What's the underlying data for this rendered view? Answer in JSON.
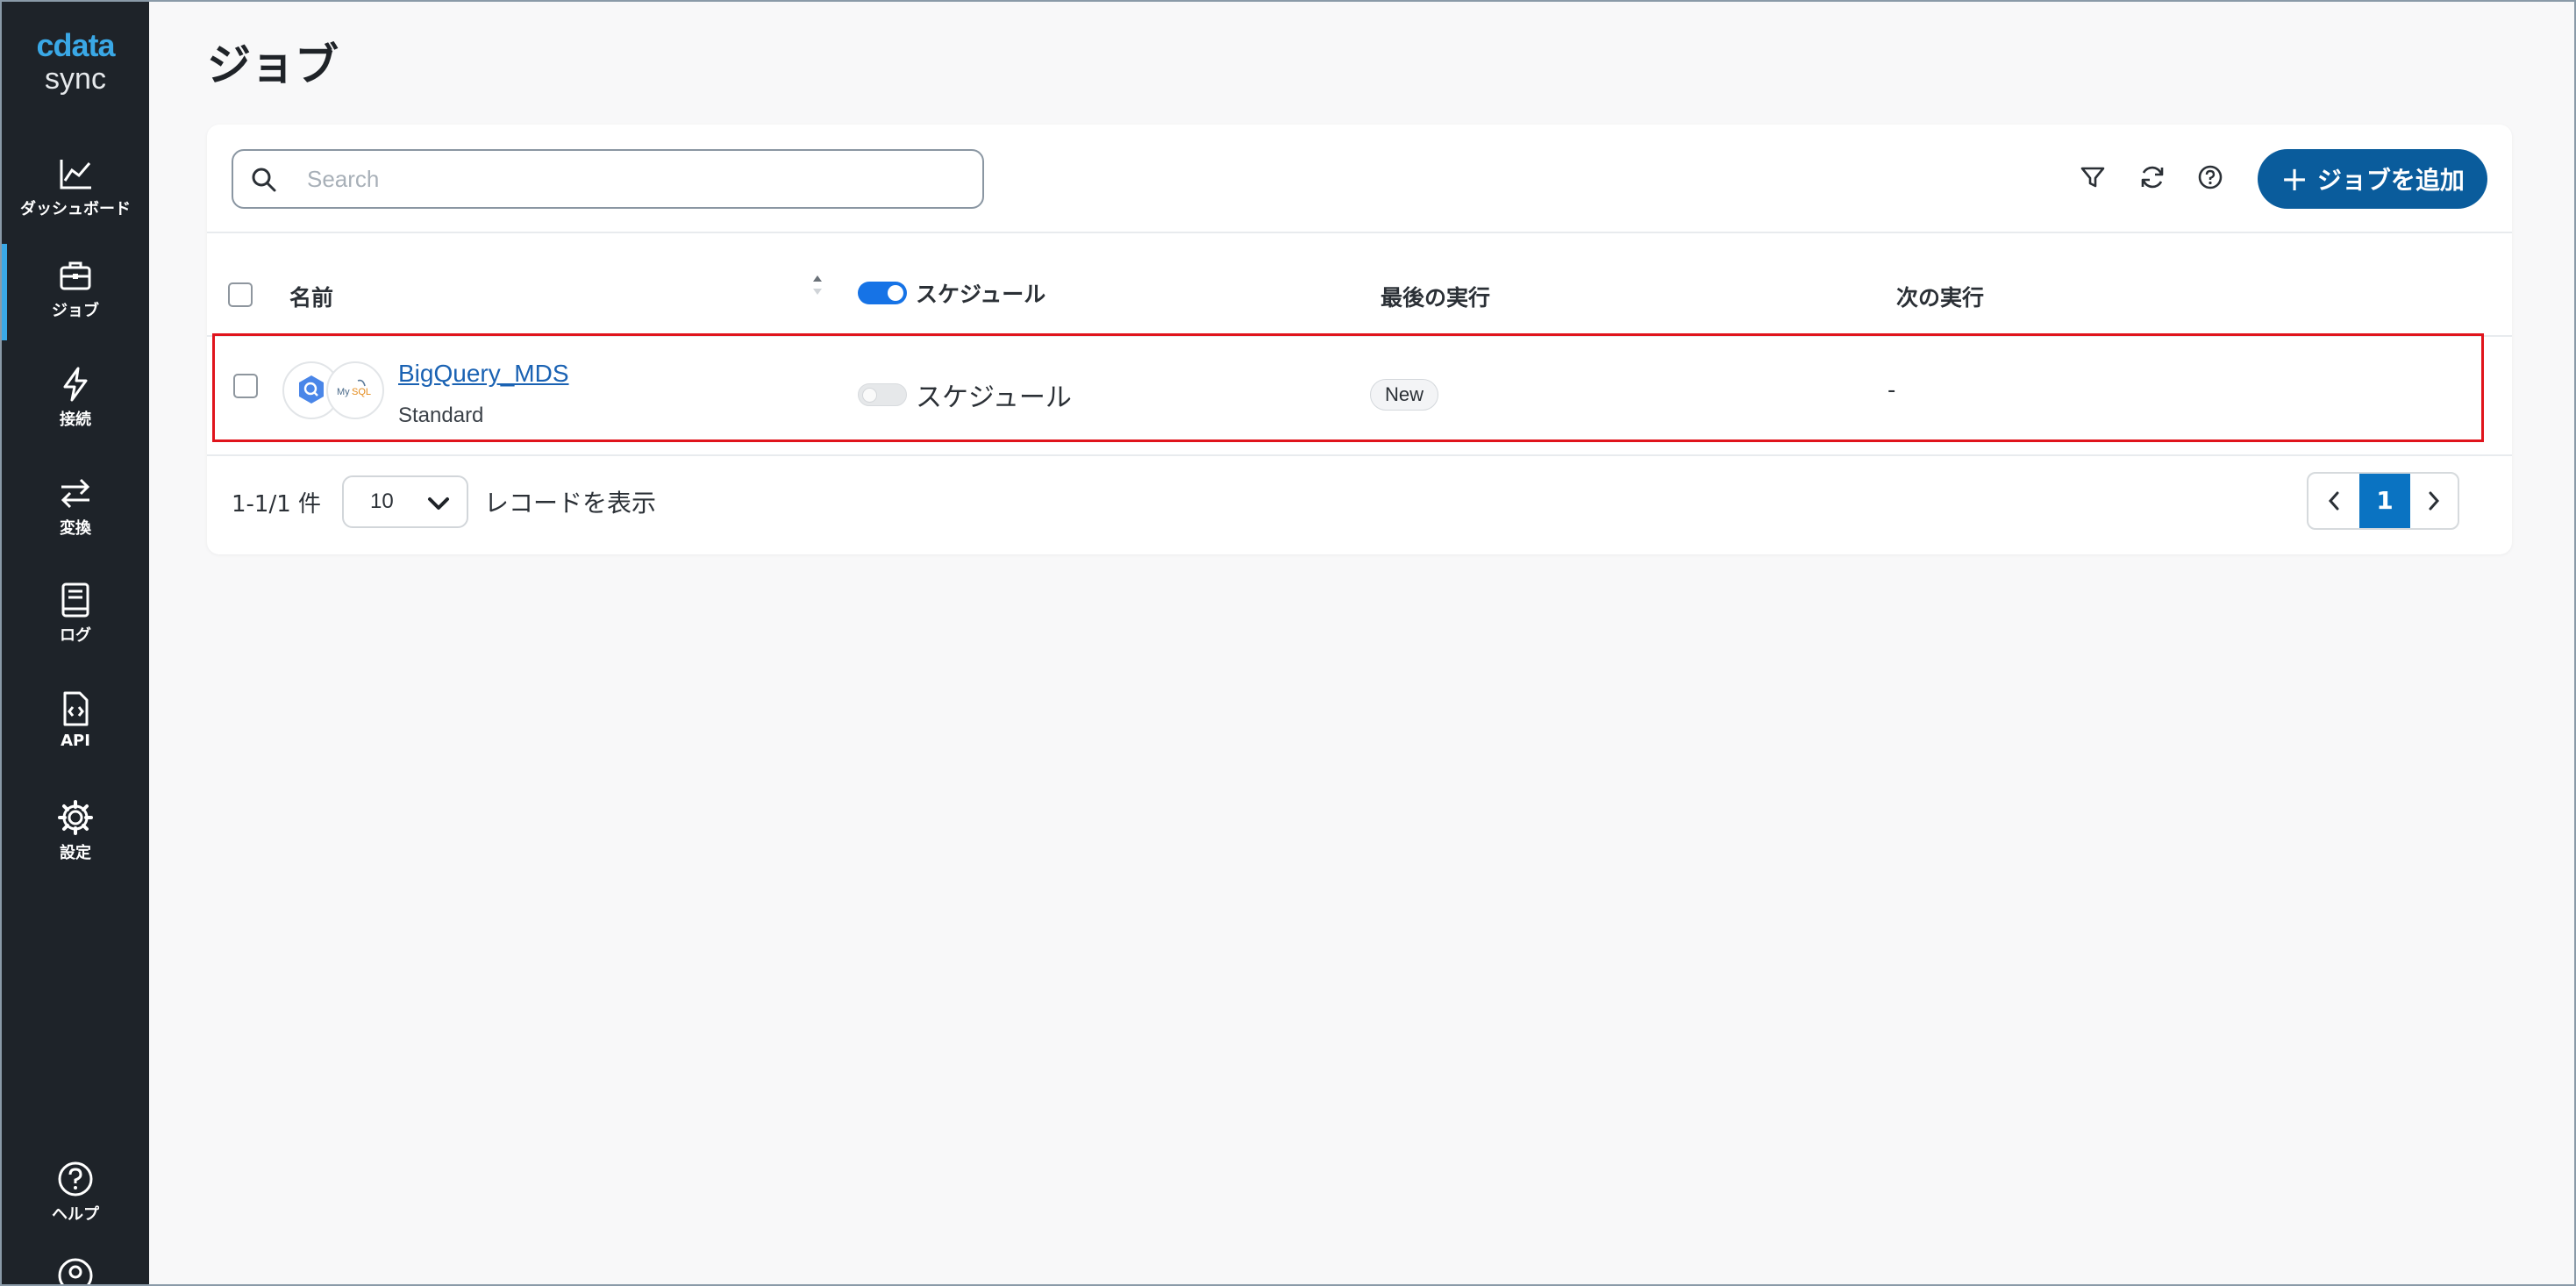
{
  "app": {
    "logo_top": "cdata",
    "logo_bottom": "sync",
    "accent_color": "#3aa8e6",
    "sidebar_bg": "#1e2329"
  },
  "sidebar": {
    "items": [
      {
        "label": "ダッシュボード",
        "icon": "chart-line-icon",
        "active": false
      },
      {
        "label": "ジョブ",
        "icon": "briefcase-icon",
        "active": true
      },
      {
        "label": "接続",
        "icon": "lightning-icon",
        "active": false
      },
      {
        "label": "変換",
        "icon": "swap-arrows-icon",
        "active": false
      },
      {
        "label": "ログ",
        "icon": "book-icon",
        "active": false
      },
      {
        "label": "API",
        "icon": "code-file-icon",
        "active": false
      },
      {
        "label": "設定",
        "icon": "gear-icon",
        "active": false
      }
    ],
    "help": {
      "label": "ヘルプ",
      "icon": "question-circle-icon"
    },
    "user": {
      "icon": "user-circle-icon"
    }
  },
  "page": {
    "title": "ジョブ"
  },
  "toolbar": {
    "search_placeholder": "Search",
    "filter_icon": "filter-icon",
    "refresh_icon": "refresh-icon",
    "help_icon": "help-circle-icon",
    "add_plus": "+",
    "add_label": "ジョブを追加",
    "add_color": "#0a5c9c"
  },
  "table": {
    "headers": {
      "name": "名前",
      "schedule": "スケジュール",
      "last_run": "最後の実行",
      "next_run": "次の実行"
    },
    "schedule_header_toggle_on": true,
    "rows": [
      {
        "name": "BigQuery_MDS",
        "type": "Standard",
        "source_icon": "bigquery-icon",
        "destination_icon": "mysql-icon",
        "schedule_label": "スケジュール",
        "schedule_enabled": false,
        "last_run": "New",
        "next_run": "-"
      }
    ]
  },
  "footer": {
    "record_range": "1-1/1 件",
    "page_size": "10",
    "page_size_suffix": "レコードを表示",
    "current_page": "1",
    "page_color": "#0a73c2"
  }
}
